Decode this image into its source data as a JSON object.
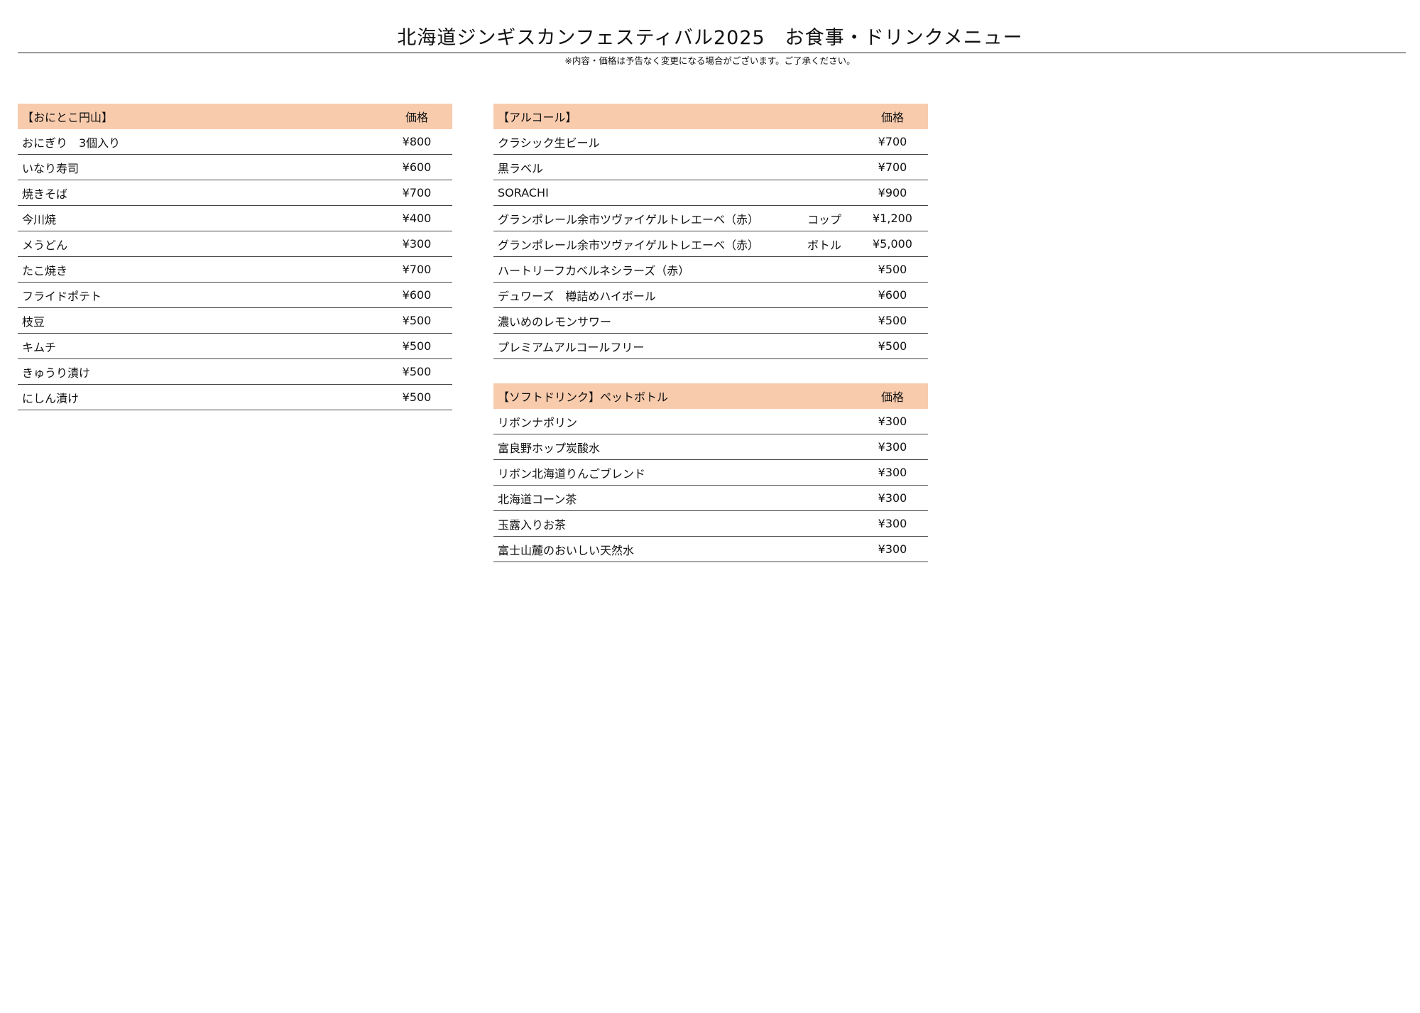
{
  "title": "北海道ジンギスカンフェスティバル2025　お食事・ドリンクメニュー",
  "notice": "※内容・価格は予告なく変更になる場合がございます。ご了承ください。",
  "colors": {
    "header_bg": "#f8cbad"
  },
  "food": {
    "header": "【おにとこ円山】",
    "price_header": "価格",
    "items": [
      {
        "name": "おにぎり　3個入り",
        "price": "¥800"
      },
      {
        "name": "いなり寿司",
        "price": "¥600"
      },
      {
        "name": "焼きそば",
        "price": "¥700"
      },
      {
        "name": "今川焼",
        "price": "¥400"
      },
      {
        "name": "メうどん",
        "price": "¥300"
      },
      {
        "name": "たこ焼き",
        "price": "¥700"
      },
      {
        "name": "フライドポテト",
        "price": "¥600"
      },
      {
        "name": "枝豆",
        "price": "¥500"
      },
      {
        "name": "キムチ",
        "price": "¥500"
      },
      {
        "name": "きゅうり漬け",
        "price": "¥500"
      },
      {
        "name": "にしん漬け",
        "price": "¥500"
      }
    ]
  },
  "alcohol": {
    "header": "【アルコール】",
    "price_header": "価格",
    "items": [
      {
        "name": "クラシック生ビール",
        "size": "",
        "price": "¥700"
      },
      {
        "name": "黒ラベル",
        "size": "",
        "price": "¥700"
      },
      {
        "name": "SORACHI",
        "size": "",
        "price": "¥900"
      },
      {
        "name": "グランポレール余市ツヴァイゲルトレエーベ（赤）",
        "size": "コップ",
        "price": "¥1,200"
      },
      {
        "name": "グランポレール余市ツヴァイゲルトレエーベ（赤）",
        "size": "ボトル",
        "price": "¥5,000"
      },
      {
        "name": "ハートリーフカベルネシラーズ（赤）",
        "size": "",
        "price": "¥500"
      },
      {
        "name": "デュワーズ　樽詰めハイボール",
        "size": "",
        "price": "¥600"
      },
      {
        "name": "濃いめのレモンサワー",
        "size": "",
        "price": "¥500"
      },
      {
        "name": "プレミアムアルコールフリー",
        "size": "",
        "price": "¥500"
      }
    ]
  },
  "soft": {
    "header": "【ソフトドリンク】ペットボトル",
    "price_header": "価格",
    "items": [
      {
        "name": "リボンナポリン",
        "price": "¥300"
      },
      {
        "name": "富良野ホップ炭酸水",
        "price": "¥300"
      },
      {
        "name": "リボン北海道りんごブレンド",
        "price": "¥300"
      },
      {
        "name": "北海道コーン茶",
        "price": "¥300"
      },
      {
        "name": "玉露入りお茶",
        "price": "¥300"
      },
      {
        "name": "富士山麓のおいしい天然水",
        "price": "¥300"
      }
    ]
  }
}
